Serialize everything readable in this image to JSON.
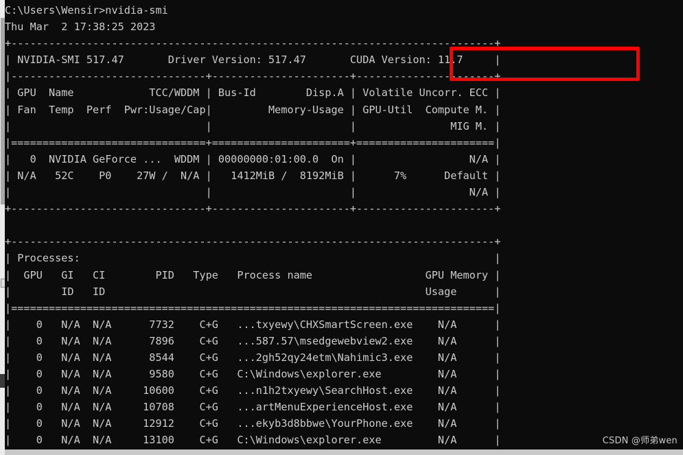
{
  "window": {
    "background_color": "#0c0c0c",
    "text_color": "#cccccc",
    "accent_color": "#ff0000"
  },
  "prompt": {
    "line": "C:\\Users\\Wensir>nvidia-smi",
    "path": "C:\\Users\\Wensir",
    "command": "nvidia-smi"
  },
  "timestamp": "Thu Mar  2 17:38:25 2023",
  "header": {
    "smi_label": "NVIDIA-SMI",
    "smi_version": "517.47",
    "driver_label": "Driver Version:",
    "driver_version": "517.47",
    "cuda_label": "CUDA Version:",
    "cuda_version": "11.7",
    "cuda_highlight_color": "#ff0000"
  },
  "gpu_table": {
    "headers_row1": [
      "GPU",
      "Name",
      "TCC/WDDM",
      "Bus-Id",
      "Disp.A",
      "Volatile Uncorr. ECC"
    ],
    "headers_row2": [
      "Fan",
      "Temp",
      "Perf",
      "Pwr:Usage/Cap",
      "Memory-Usage",
      "GPU-Util",
      "Compute M."
    ],
    "headers_row3": [
      "MIG M."
    ],
    "rows": [
      {
        "gpu": "0",
        "name": "NVIDIA GeForce ...",
        "tcc_wddm": "WDDM",
        "bus_id": "00000000:01:00.0",
        "disp_a": "On",
        "ecc": "N/A",
        "fan": "N/A",
        "temp": "52C",
        "perf": "P0",
        "pwr_usage": "27W",
        "pwr_cap": "N/A",
        "memory_used": "1412MiB",
        "memory_total": "8192MiB",
        "gpu_util": "7%",
        "compute_mode": "Default",
        "mig_mode": "N/A"
      }
    ]
  },
  "processes": {
    "title": "Processes:",
    "headers_row1": [
      "GPU",
      "GI",
      "CI",
      "PID",
      "Type",
      "Process name",
      "GPU Memory"
    ],
    "headers_row2": [
      "ID",
      "ID",
      "Usage"
    ],
    "rows": [
      {
        "gpu": "0",
        "gi_id": "N/A",
        "ci_id": "N/A",
        "pid": "7732",
        "type": "C+G",
        "process_name": "...txyewy\\CHXSmartScreen.exe",
        "gpu_memory": "N/A"
      },
      {
        "gpu": "0",
        "gi_id": "N/A",
        "ci_id": "N/A",
        "pid": "7896",
        "type": "C+G",
        "process_name": "...587.57\\msedgewebview2.exe",
        "gpu_memory": "N/A"
      },
      {
        "gpu": "0",
        "gi_id": "N/A",
        "ci_id": "N/A",
        "pid": "8544",
        "type": "C+G",
        "process_name": "...2gh52qy24etm\\Nahimic3.exe",
        "gpu_memory": "N/A"
      },
      {
        "gpu": "0",
        "gi_id": "N/A",
        "ci_id": "N/A",
        "pid": "9580",
        "type": "C+G",
        "process_name": "C:\\Windows\\explorer.exe",
        "gpu_memory": "N/A"
      },
      {
        "gpu": "0",
        "gi_id": "N/A",
        "ci_id": "N/A",
        "pid": "10600",
        "type": "C+G",
        "process_name": "...n1h2txyewy\\SearchHost.exe",
        "gpu_memory": "N/A"
      },
      {
        "gpu": "0",
        "gi_id": "N/A",
        "ci_id": "N/A",
        "pid": "10708",
        "type": "C+G",
        "process_name": "...artMenuExperienceHost.exe",
        "gpu_memory": "N/A"
      },
      {
        "gpu": "0",
        "gi_id": "N/A",
        "ci_id": "N/A",
        "pid": "12912",
        "type": "C+G",
        "process_name": "...ekyb3d8bbwe\\YourPhone.exe",
        "gpu_memory": "N/A"
      },
      {
        "gpu": "0",
        "gi_id": "N/A",
        "ci_id": "N/A",
        "pid": "13100",
        "type": "C+G",
        "process_name": "C:\\Windows\\explorer.exe",
        "gpu_memory": "N/A"
      }
    ]
  },
  "terminal_output": "C:\\Users\\Wensir>nvidia-smi\nThu Mar  2 17:38:25 2023\n+-----------------------------------------------------------------------------+\n| NVIDIA-SMI 517.47       Driver Version: 517.47       CUDA Version: 11.7     |\n|-------------------------------+----------------------+----------------------+\n| GPU  Name            TCC/WDDM | Bus-Id        Disp.A | Volatile Uncorr. ECC |\n| Fan  Temp  Perf  Pwr:Usage/Cap|         Memory-Usage | GPU-Util  Compute M. |\n|                               |                      |               MIG M. |\n|===============================+======================+======================|\n|   0  NVIDIA GeForce ...  WDDM | 00000000:01:00.0  On |                  N/A |\n| N/A   52C    P0    27W /  N/A |   1412MiB /  8192MiB |      7%      Default |\n|                               |                      |                  N/A |\n+-------------------------------+----------------------+----------------------+\n                                                                               \n+-----------------------------------------------------------------------------+\n| Processes:                                                                  |\n|  GPU   GI   CI        PID   Type   Process name                  GPU Memory |\n|        ID   ID                                                   Usage      |\n|=============================================================================|\n|    0   N/A  N/A      7732    C+G   ...txyewy\\CHXSmartScreen.exe    N/A      |\n|    0   N/A  N/A      7896    C+G   ...587.57\\msedgewebview2.exe    N/A      |\n|    0   N/A  N/A      8544    C+G   ...2gh52qy24etm\\Nahimic3.exe    N/A      |\n|    0   N/A  N/A      9580    C+G   C:\\Windows\\explorer.exe         N/A      |\n|    0   N/A  N/A     10600    C+G   ...n1h2txyewy\\SearchHost.exe    N/A      |\n|    0   N/A  N/A     10708    C+G   ...artMenuExperienceHost.exe    N/A      |\n|    0   N/A  N/A     12912    C+G   ...ekyb3d8bbwe\\YourPhone.exe    N/A      |\n|    0   N/A  N/A     13100    C+G   C:\\Windows\\explorer.exe         N/A      |",
  "watermark": "CSDN @师弟wen"
}
